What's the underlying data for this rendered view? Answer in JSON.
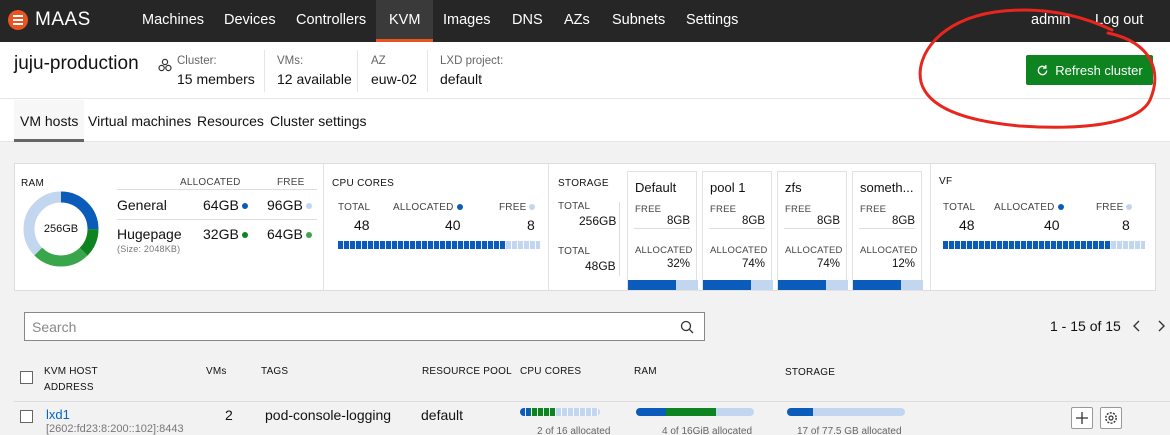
{
  "nav": {
    "brand": "MAAS",
    "items": [
      "Machines",
      "Devices",
      "Controllers",
      "KVM",
      "Images",
      "DNS",
      "AZs",
      "Subnets",
      "Settings"
    ],
    "active": "KVM",
    "user": "admin",
    "logout": "Log out"
  },
  "header": {
    "title": "juju-production",
    "cluster_label": "Cluster:",
    "cluster_value": "15 members",
    "vms_label": "VMs:",
    "vms_value": "12 available",
    "az_label": "AZ",
    "az_value": "euw-02",
    "project_label": "LXD project:",
    "project_value": "default",
    "refresh_label": "Refresh cluster"
  },
  "tabs": [
    "VM hosts",
    "Virtual machines",
    "Resources",
    "Cluster settings"
  ],
  "resources": {
    "ram": {
      "title": "RAM",
      "center": "256GB",
      "allocated_header": "ALLOCATED",
      "free_header": "FREE",
      "general_label": "General",
      "general_allocated": "64GB",
      "general_free": "96GB",
      "hugepage_label": "Hugepage",
      "hugepage_note": "(Size: 2048KB)",
      "hugepage_allocated": "32GB",
      "hugepage_free": "64GB",
      "donut_fractions": {
        "general_allocated": 0.25,
        "hugepage_allocated": 0.125,
        "hugepage_free": 0.25,
        "general_free": 0.375
      }
    },
    "cpu": {
      "title": "CPU CORES",
      "total_label": "TOTAL",
      "allocated_label": "ALLOCATED",
      "free_label": "FREE",
      "total": "48",
      "allocated": "40",
      "free": "8",
      "fraction": 0.833
    },
    "storage": {
      "title": "STORAGE",
      "total_label": "TOTAL",
      "total_1": "256GB",
      "total_2": "48GB",
      "free_label": "FREE",
      "allocated_label": "ALLOCATED",
      "pools": [
        {
          "name": "Default",
          "free": "8GB",
          "allocated": "32%",
          "fraction": 0.68
        },
        {
          "name": "pool 1",
          "free": "8GB",
          "allocated": "74%",
          "fraction": 0.68
        },
        {
          "name": "zfs",
          "free": "8GB",
          "allocated": "74%",
          "fraction": 0.68
        },
        {
          "name": "someth...",
          "free": "8GB",
          "allocated": "12%",
          "fraction": 0.68
        }
      ]
    },
    "vf": {
      "title": "VF",
      "total_label": "TOTAL",
      "allocated_label": "ALLOCATED",
      "free_label": "FREE",
      "total": "48",
      "allocated": "40",
      "free": "8",
      "fraction": 0.833
    }
  },
  "search": {
    "placeholder": "Search"
  },
  "pagination": {
    "text": "1 - 15 of 15"
  },
  "table": {
    "headers": {
      "host_1": "KVM HOST",
      "host_2": "ADDRESS",
      "vms": "VMs",
      "tags": "TAGS",
      "pool": "RESOURCE POOL",
      "cpu": "CPU CORES",
      "ram": "RAM",
      "storage": "STORAGE"
    },
    "rows": [
      {
        "name": "lxd1",
        "address": "[2602:fd23:8:200::102]:8443",
        "vms": "2",
        "tags": "pod-console-logging",
        "pool": "default",
        "cpu_text": "2 of 16 allocated",
        "cpu_fraction": 0.125,
        "ram_text": "4 of 16GiB allocated",
        "ram_fraction": 0.25,
        "storage_text": "17 of 77.5 GB allocated",
        "storage_fraction": 0.22
      }
    ]
  },
  "colors": {
    "nav_bg": "#262626",
    "accent": "#e95420",
    "refresh_btn": "#0e8420",
    "allocated": "#0b5cba",
    "free": "#c3d6ef",
    "hugepage_allocated": "#0e8420",
    "hugepage_free": "#3aa64c",
    "link": "#0066cc",
    "annotation": "#e8261e"
  }
}
